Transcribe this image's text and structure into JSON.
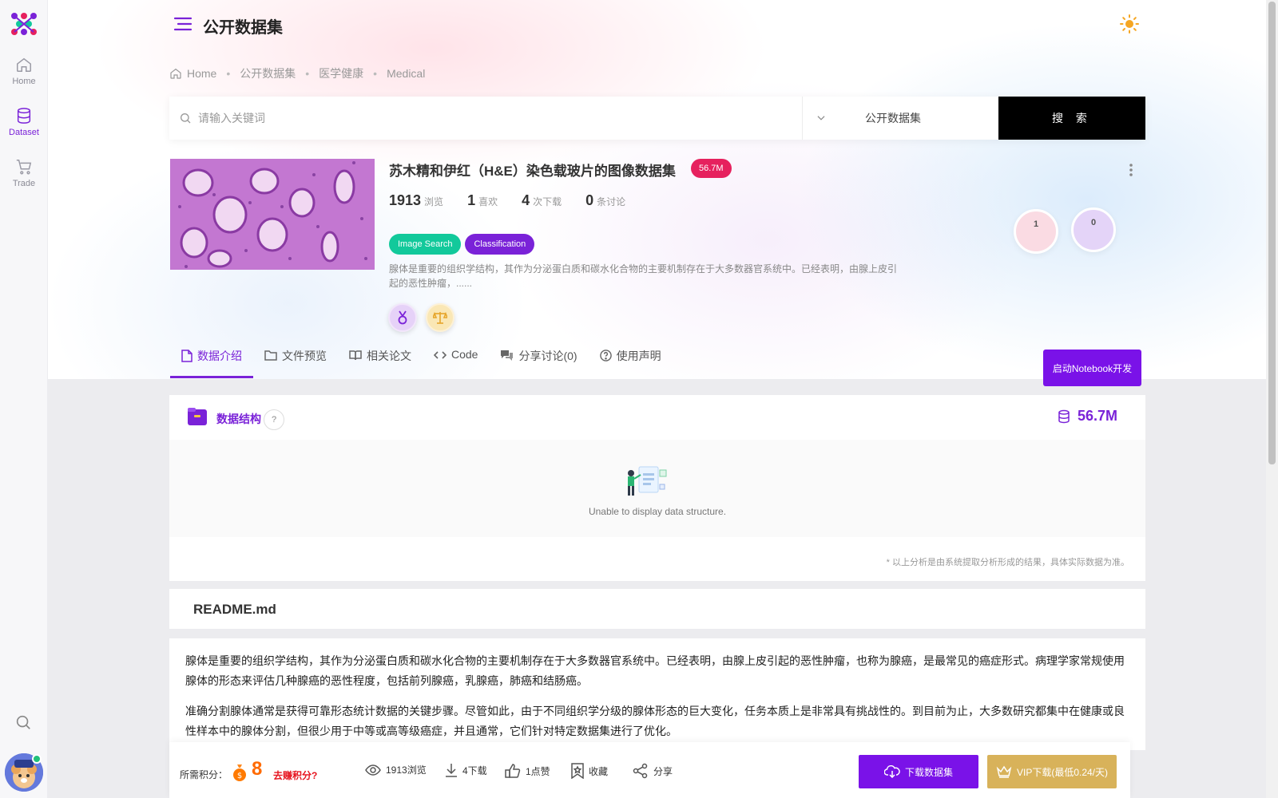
{
  "sidebar": {
    "items": [
      {
        "label": "Home",
        "icon": "home-icon"
      },
      {
        "label": "Dataset",
        "icon": "database-icon"
      },
      {
        "label": "Trade",
        "icon": "cart-icon"
      }
    ],
    "active_color": "#7a22d8"
  },
  "header": {
    "title": "公开数据集"
  },
  "breadcrumb": [
    "Home",
    "公开数据集",
    "医学健康",
    "Medical"
  ],
  "search": {
    "placeholder": "请输入关键词",
    "value": "",
    "scope": "公开数据集",
    "button": "搜 索"
  },
  "dataset": {
    "title": "苏木精和伊红（H&E）染色载玻片的图像数据集",
    "size_badge": "56.7M",
    "stats": [
      {
        "value": "1913",
        "label": "浏览"
      },
      {
        "value": "1",
        "label": "喜欢"
      },
      {
        "value": "4",
        "label": "次下载"
      },
      {
        "value": "0",
        "label": "条讨论"
      }
    ],
    "tags": [
      "Image Search",
      "Classification"
    ],
    "description": "腺体是重要的组织学结构，其作为分泌蛋白质和碳水化合物的主要机制存在于大多数器官系统中。已经表明，由腺上皮引起的恶性肿瘤，......",
    "bubbles": [
      "1",
      "0"
    ]
  },
  "tabs": [
    "数据介绍",
    "文件预览",
    "相关论文",
    "Code",
    "分享讨论(0)",
    "使用声明"
  ],
  "notebook_button": "启动Notebook开发",
  "structure": {
    "title": "数据结构",
    "help": "?",
    "size": "56.7M",
    "empty_text": "Unable to display data structure.",
    "note": "* 以上分析是由系统提取分析形成的结果，具体实际数据为准。"
  },
  "readme": {
    "title": "README.md",
    "paragraphs": [
      "腺体是重要的组织学结构，其作为分泌蛋白质和碳水化合物的主要机制存在于大多数器官系统中。已经表明，由腺上皮引起的恶性肿瘤，也称为腺癌，是最常见的癌症形式。病理学家常规使用腺体的形态来评估几种腺癌的恶性程度，包括前列腺癌，乳腺癌，肺癌和结肠癌。",
      "准确分割腺体通常是获得可靠形态统计数据的关键步骤。尽管如此，由于不同组织学分级的腺体形态的巨大变化，任务本质上是非常具有挑战性的。到目前为止，大多数研究都集中在健康或良性样本中的腺体分割，但很少用于中等或高等级癌症，并且通常，它们针对特定数据集进行了优化。"
    ]
  },
  "bottom_bar": {
    "points_label": "所需积分：",
    "points_value": "8",
    "earn_link": "去赚积分?",
    "views": "1913浏览",
    "downloads": "4下载",
    "likes": "1点赞",
    "favorite": "收藏",
    "share": "分享",
    "download_button": "下载数据集",
    "vip_button": "VIP下载(最低0.24/天)"
  },
  "colors": {
    "brand": "#7a22d8",
    "badge": "#e6215e",
    "tag_green": "#12c99b",
    "vip_gold": "#d8b25a",
    "points_orange": "#ff6a00"
  }
}
